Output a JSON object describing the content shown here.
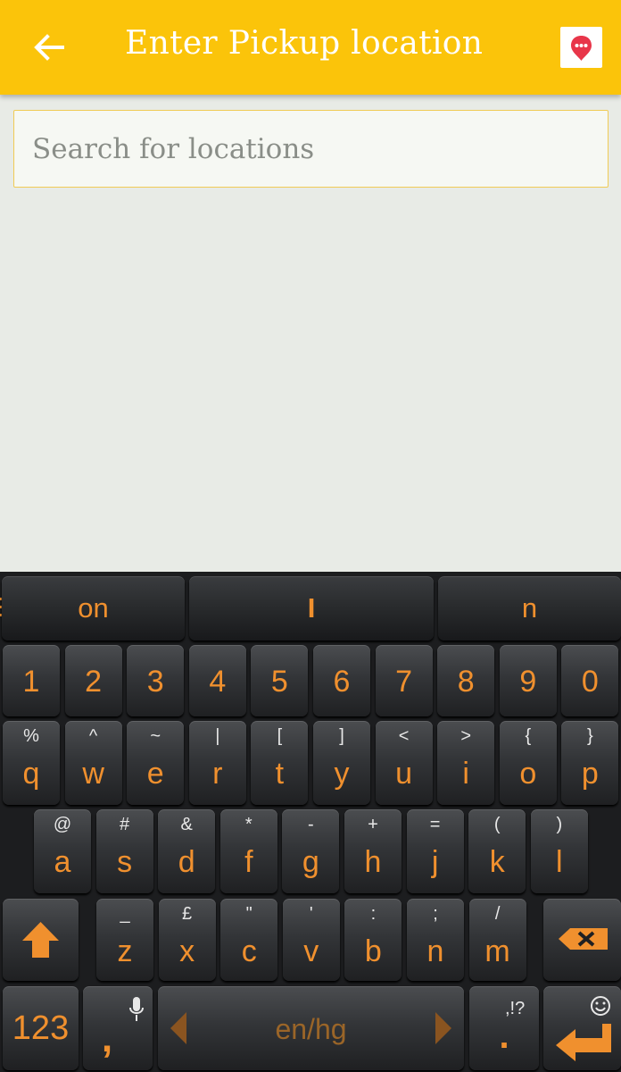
{
  "header": {
    "title": "Enter Pickup location",
    "back_icon": "arrow-left-icon",
    "map_icon": "map-pin-chat-icon"
  },
  "search": {
    "placeholder": "Search for locations",
    "value": ""
  },
  "colors": {
    "header_bg": "#fbc40a",
    "key_text": "#f0902e",
    "keyboard_bg": "#1c1d1f",
    "page_bg": "#e8ebe6"
  },
  "keyboard": {
    "suggestions": [
      "on",
      "I",
      "n"
    ],
    "numbers": [
      "1",
      "2",
      "3",
      "4",
      "5",
      "6",
      "7",
      "8",
      "9",
      "0"
    ],
    "row1": [
      {
        "k": "q",
        "a": "%"
      },
      {
        "k": "w",
        "a": "^"
      },
      {
        "k": "e",
        "a": "~"
      },
      {
        "k": "r",
        "a": "|"
      },
      {
        "k": "t",
        "a": "["
      },
      {
        "k": "y",
        "a": "]"
      },
      {
        "k": "u",
        "a": "<"
      },
      {
        "k": "i",
        "a": ">"
      },
      {
        "k": "o",
        "a": "{"
      },
      {
        "k": "p",
        "a": "}"
      }
    ],
    "row2": [
      {
        "k": "a",
        "a": "@"
      },
      {
        "k": "s",
        "a": "#"
      },
      {
        "k": "d",
        "a": "&"
      },
      {
        "k": "f",
        "a": "*"
      },
      {
        "k": "g",
        "a": "-"
      },
      {
        "k": "h",
        "a": "+"
      },
      {
        "k": "j",
        "a": "="
      },
      {
        "k": "k",
        "a": "("
      },
      {
        "k": "l",
        "a": ")"
      }
    ],
    "row3": [
      {
        "k": "z",
        "a": "_"
      },
      {
        "k": "x",
        "a": "£"
      },
      {
        "k": "c",
        "a": "\""
      },
      {
        "k": "v",
        "a": "'"
      },
      {
        "k": "b",
        "a": ":"
      },
      {
        "k": "n",
        "a": ";"
      },
      {
        "k": "m",
        "a": "/"
      }
    ],
    "symbols_key": "123",
    "comma_key": ",",
    "space_label": "en/hg",
    "period_key": ".",
    "period_alt": ",!?"
  }
}
